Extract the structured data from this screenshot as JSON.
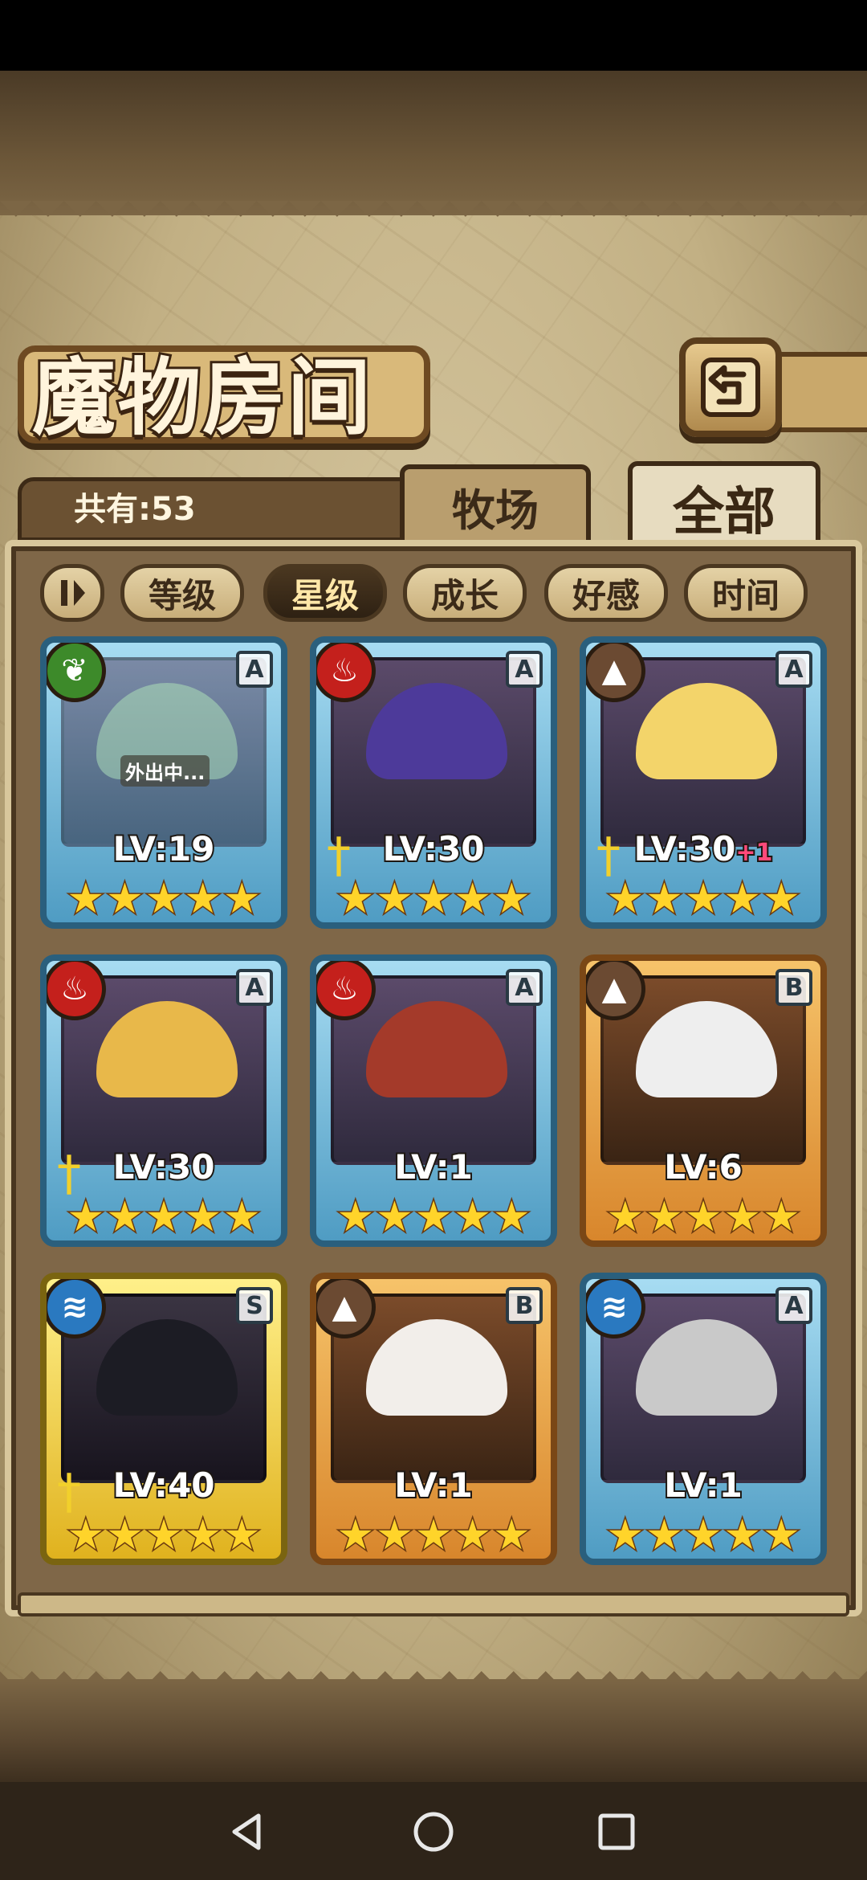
{
  "title": "魔物房间",
  "count_label": "共有:53",
  "tabs": [
    {
      "label": "牧场",
      "active": false
    },
    {
      "label": "全部",
      "active": true
    }
  ],
  "sort_buttons": [
    {
      "label": "等级",
      "active": false
    },
    {
      "label": "星级",
      "active": true
    },
    {
      "label": "成长",
      "active": false
    },
    {
      "label": "好感",
      "active": false
    },
    {
      "label": "时间",
      "active": false
    }
  ],
  "cards": [
    {
      "element": "leaf-icon",
      "rank": "A",
      "level": "LV:19",
      "bonus": "",
      "stars": 5,
      "frame": "blue",
      "weapon": false,
      "status": "外出中...",
      "hair_color": "#8fa07a"
    },
    {
      "element": "fire-icon",
      "rank": "A",
      "level": "LV:30",
      "bonus": "",
      "stars": 5,
      "frame": "blue",
      "weapon": true,
      "status": "",
      "hair_color": "#4d3a9a"
    },
    {
      "element": "earth-icon",
      "rank": "A",
      "level": "LV:30",
      "bonus": "+1",
      "stars": 5,
      "frame": "blue",
      "weapon": true,
      "status": "",
      "hair_color": "#f3d46a"
    },
    {
      "element": "fire-icon",
      "rank": "A",
      "level": "LV:30",
      "bonus": "",
      "stars": 5,
      "frame": "blue",
      "weapon": true,
      "status": "",
      "hair_color": "#e8b84a"
    },
    {
      "element": "fire-icon",
      "rank": "A",
      "level": "LV:1",
      "bonus": "",
      "stars": 5,
      "frame": "blue",
      "weapon": false,
      "status": "",
      "hair_color": "#a43a2a"
    },
    {
      "element": "earth-icon",
      "rank": "B",
      "level": "LV:6",
      "bonus": "",
      "stars": 5,
      "frame": "orange",
      "weapon": false,
      "status": "",
      "hair_color": "#eeeeee"
    },
    {
      "element": "water-icon",
      "rank": "S",
      "level": "LV:40",
      "bonus": "",
      "stars": 5,
      "frame": "gold",
      "weapon": true,
      "status": "",
      "hair_color": "#1c1c24"
    },
    {
      "element": "earth-icon",
      "rank": "B",
      "level": "LV:1",
      "bonus": "",
      "stars": 5,
      "frame": "orange",
      "weapon": false,
      "status": "",
      "hair_color": "#f2eeea"
    },
    {
      "element": "water-icon",
      "rank": "A",
      "level": "LV:1",
      "bonus": "",
      "stars": 5,
      "frame": "blue",
      "weapon": false,
      "status": "",
      "hair_color": "#c9c9c9"
    }
  ],
  "icons": {
    "leaf-icon": "❦",
    "fire-icon": "♨",
    "earth-icon": "▲",
    "water-icon": "≋",
    "weapon": "†",
    "star": "★",
    "back": "↵"
  },
  "colors": {
    "frame_blue": "#2a5f7d",
    "frame_orange": "#7a4716",
    "frame_gold": "#7a6410",
    "level_bonus": "#ff4a7a",
    "star": "#ffd42a"
  }
}
